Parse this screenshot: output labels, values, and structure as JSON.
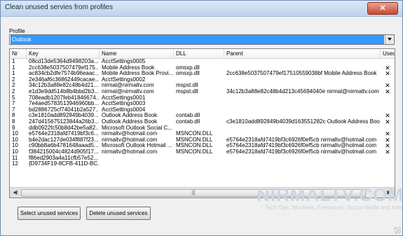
{
  "window": {
    "title": "Clean unused servies from profiles",
    "close_glyph": "✕"
  },
  "profile": {
    "label": "Profile",
    "selected": "Outlook"
  },
  "list": {
    "columns": [
      "Nr",
      "Key",
      "Name",
      "DLL",
      "Parent",
      "Used"
    ],
    "rows": [
      {
        "nr": "1",
        "key": "08cd13de5364d9498203a...",
        "name": "AcctSettings0005",
        "dll": "",
        "parent": "",
        "used": ""
      },
      {
        "nr": "1",
        "key": "2cc638e5037507479ef175...",
        "name": "Mobile Address Book",
        "dll": "omsxp.dll",
        "parent": "",
        "used": "✕"
      },
      {
        "nr": "1",
        "key": "ac834cb2dfe7574b96eaac...",
        "name": "Mobile Address Book Provi...",
        "dll": "omsxp.dll",
        "parent": "2cc638e5037507479ef17510559038bf Mobile Address Book",
        "used": "✕"
      },
      {
        "nr": "2",
        "key": "2e346af6c36862449cacae...",
        "name": "AcctSettings0002",
        "dll": "",
        "parent": "",
        "used": ""
      },
      {
        "nr": "2",
        "key": "34c12b3a88e82c48b4d21...",
        "name": "nirmal@nirmaltv.com",
        "dll": "mspst.dll",
        "parent": "",
        "used": "✕"
      },
      {
        "nr": "2",
        "key": "e1d3e9dd514b8b4bbd2b3...",
        "name": "nirmal@nirmaltv.com",
        "dll": "mspst.dll",
        "parent": "34c12b3a88e82c48b4d213c45694040e nirmal@nirmaltv.com",
        "used": "✕"
      },
      {
        "nr": "5",
        "key": "708eadb1207feb41846674...",
        "name": "AcctSettings0001",
        "dll": "",
        "parent": "",
        "used": ""
      },
      {
        "nr": "7",
        "key": "7e4aed5783513946960bb...",
        "name": "AcctSettings0003",
        "dll": "",
        "parent": "",
        "used": ""
      },
      {
        "nr": "7",
        "key": "bd2886725cf74041b2a527...",
        "name": "AcctSettings0004",
        "dll": "",
        "parent": "",
        "used": ""
      },
      {
        "nr": "8",
        "key": "c3e1810add892849b4039...",
        "name": "Outlook Address Book",
        "dll": "contab.dll",
        "parent": "",
        "used": "✕"
      },
      {
        "nr": "8",
        "key": "247d415675123844a26b3...",
        "name": "Outlook Address Book",
        "dll": "contab.dll",
        "parent": "c3e1810add892849b4039d163551282c Outlook Address Book",
        "used": "✕"
      },
      {
        "nr": "9",
        "key": "ddb0922fc50b8d42be5a82...",
        "name": "Microsoft Outlook Social C...",
        "dll": "",
        "parent": "",
        "used": ""
      },
      {
        "nr": "10",
        "key": "e5764e2318afd7419bf3c6...",
        "name": "nirmaltv@hotmail.com",
        "dll": "MSNCON.DLL",
        "parent": "",
        "used": "✕"
      },
      {
        "nr": "10",
        "key": "b4e2dac127de034f887f23...",
        "name": "nirmaltv@hotmail.com",
        "dll": "MSNCON.DLL",
        "parent": "e5764e2318afd7419bf3c6926f0ef5cb nirmaltv@hotmail.com",
        "used": "✕"
      },
      {
        "nr": "10",
        "key": "c90bb8a6b4781648aaad5...",
        "name": "Microsoft Outlook Hotmail ...",
        "dll": "MSNCON.DLL",
        "parent": "e5764e2318afd7419bf3c6926f0ef5cb nirmaltv@hotmail.com",
        "used": "✕"
      },
      {
        "nr": "10",
        "key": "f384215004c4824d905f17...",
        "name": "nirmaltv@hotmail.com",
        "dll": "MSNCON.DLL",
        "parent": "e5764e2318afd7419bf3c6926f0ef5cb nirmaltv@hotmail.com",
        "used": "✕"
      },
      {
        "nr": "11",
        "key": "f86ed2903a4a11cfb57e52...",
        "name": "",
        "dll": "",
        "parent": "",
        "used": ""
      },
      {
        "nr": "12",
        "key": "{D9734F19-8CFB-411D-BC...",
        "name": "",
        "dll": "",
        "parent": "",
        "used": ""
      }
    ]
  },
  "scrollbar": {
    "left_glyph": "◀",
    "right_glyph": "▶",
    "thumb_grip": "|||"
  },
  "buttons": {
    "select_unused": "Select unused services",
    "delete_unused": "Delete unused services"
  },
  "watermark": {
    "title": "NIRMALTV.COM",
    "subtitle": "Tech Tips, Windows, Freewares, Social Media and Internet"
  }
}
